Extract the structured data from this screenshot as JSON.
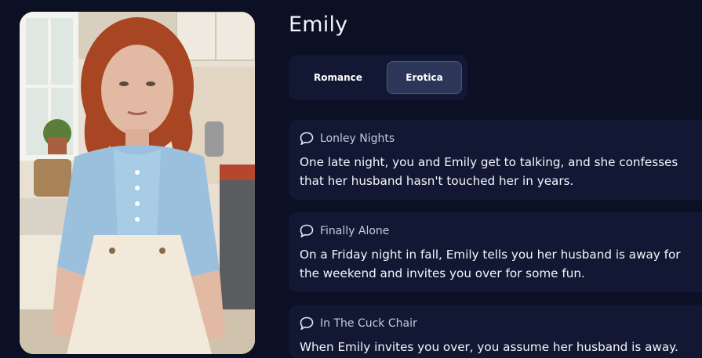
{
  "character": {
    "name": "Emily",
    "portrait_alt": "Emily portrait"
  },
  "tabs": [
    {
      "label": "Romance",
      "selected": false
    },
    {
      "label": "Erotica",
      "selected": true
    }
  ],
  "scenarios": [
    {
      "icon": "chat-bubble-icon",
      "title": "Lonley Nights",
      "description": "One late night, you and Emily get to talking, and she confesses that her husband hasn't touched her in years."
    },
    {
      "icon": "chat-bubble-icon",
      "title": "Finally Alone",
      "description": "On a Friday night in fall, Emily tells you her husband is away for the weekend and invites you over for some fun."
    },
    {
      "icon": "chat-bubble-icon",
      "title": "In The Cuck Chair",
      "description": "When Emily invites you over, you assume her husband is away."
    }
  ],
  "colors": {
    "background": "#0c1024",
    "card": "#121833",
    "tab_selected": "#2b3659",
    "title_text": "#c5cadb"
  }
}
